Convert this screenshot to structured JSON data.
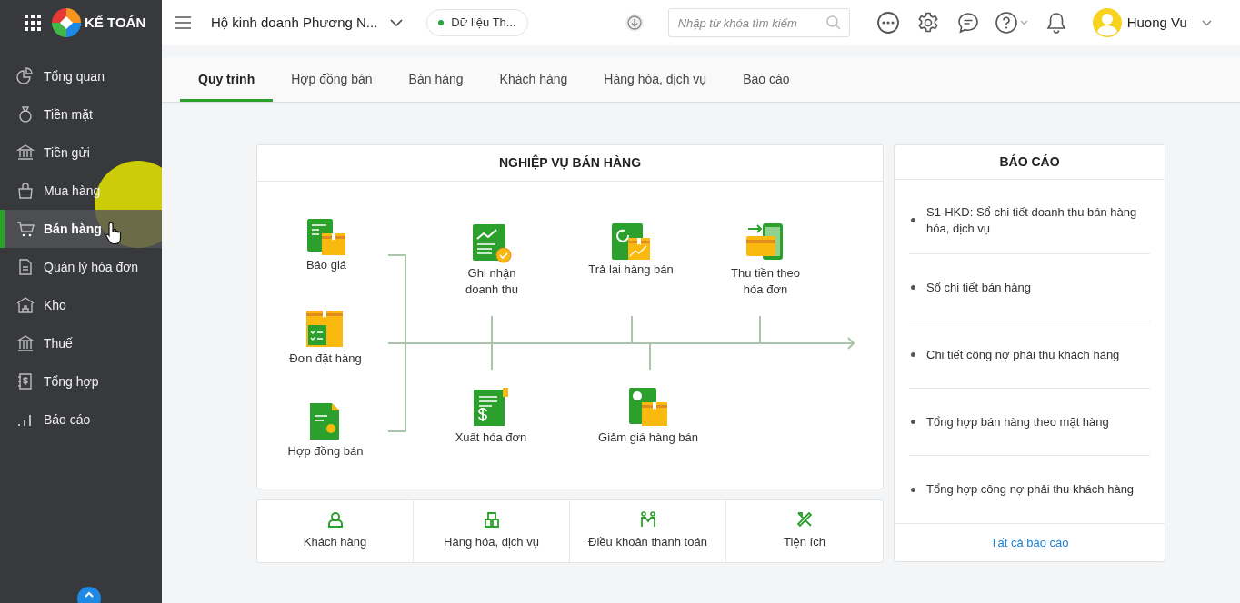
{
  "app": {
    "logo_text": "KẾ TOÁN"
  },
  "sidebar": {
    "items": [
      {
        "label": "Tổng quan",
        "selected": false
      },
      {
        "label": "Tiền mặt",
        "selected": false
      },
      {
        "label": "Tiền gửi",
        "selected": false
      },
      {
        "label": "Mua hàng",
        "selected": false
      },
      {
        "label": "Bán hàng",
        "selected": true
      },
      {
        "label": "Quản lý hóa đơn",
        "selected": false
      },
      {
        "label": "Kho",
        "selected": false
      },
      {
        "label": "Thuế",
        "selected": false
      },
      {
        "label": "Tổng hợp",
        "selected": false
      },
      {
        "label": "Báo cáo",
        "selected": false
      }
    ]
  },
  "topbar": {
    "company": "Hộ kinh doanh Phương N...",
    "data_badge": "Dữ liệu Th...",
    "search": {
      "placeholder": "Nhập từ khóa tìm kiếm"
    },
    "user": "Huong Vu"
  },
  "tabs": [
    {
      "label": "Quy trình",
      "selected": true
    },
    {
      "label": "Hợp đồng bán",
      "selected": false
    },
    {
      "label": "Bán hàng",
      "selected": false
    },
    {
      "label": "Khách hàng",
      "selected": false
    },
    {
      "label": "Hàng hóa, dịch vụ",
      "selected": false
    },
    {
      "label": "Báo cáo",
      "selected": false
    }
  ],
  "process": {
    "title": "NGHIỆP VỤ BÁN HÀNG",
    "steps": [
      {
        "label": "Báo giá"
      },
      {
        "label": "Đơn đặt hàng"
      },
      {
        "label": "Hợp đồng bán"
      },
      {
        "label": "Ghi nhận doanh thu"
      },
      {
        "label": "Trả lại hàng bán"
      },
      {
        "label": "Thu tiền theo hóa đơn"
      },
      {
        "label": "Xuất hóa đơn"
      },
      {
        "label": "Giảm giá hàng bán"
      }
    ]
  },
  "shortcuts": [
    {
      "label": "Khách hàng"
    },
    {
      "label": "Hàng hóa, dịch vụ"
    },
    {
      "label": "Điều khoản thanh toán"
    },
    {
      "label": "Tiện ích"
    }
  ],
  "reports": {
    "title": "BÁO CÁO",
    "items": [
      "S1-HKD: Sổ chi tiết doanh thu bán hàng hóa, dịch vụ",
      "Sổ chi tiết bán hàng",
      "Chi tiết công nợ phải thu khách hàng",
      "Tổng hợp bán hàng theo mặt hàng",
      "Tổng hợp công nợ phải thu khách hàng"
    ],
    "footer_link": "Tất cả báo cáo"
  }
}
